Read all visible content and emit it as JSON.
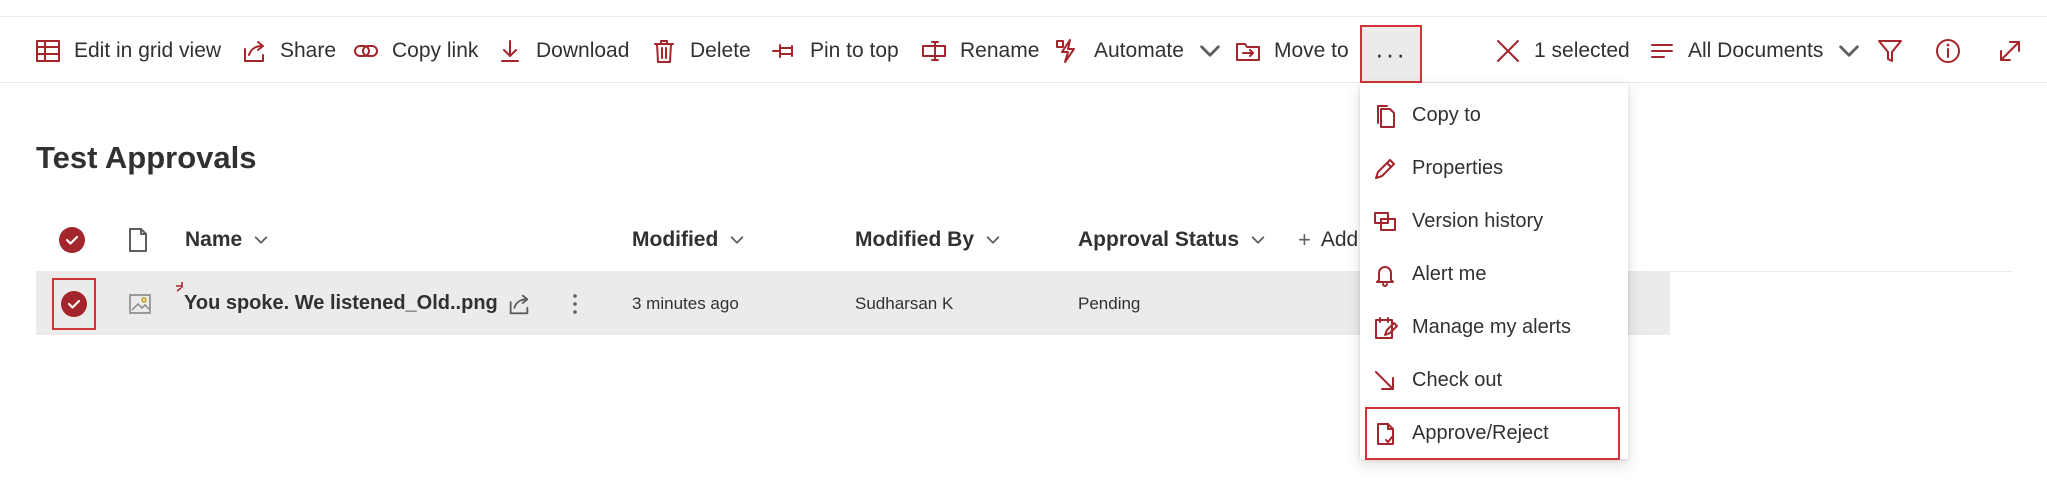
{
  "commandbar": {
    "items": [
      {
        "label": "Edit in grid view",
        "icon": "grid-icon"
      },
      {
        "label": "Share",
        "icon": "share-icon"
      },
      {
        "label": "Copy link",
        "icon": "link-icon"
      },
      {
        "label": "Download",
        "icon": "download-icon"
      },
      {
        "label": "Delete",
        "icon": "delete-icon"
      },
      {
        "label": "Pin to top",
        "icon": "pin-icon"
      },
      {
        "label": "Rename",
        "icon": "rename-icon"
      },
      {
        "label": "Automate",
        "icon": "automate-icon"
      },
      {
        "label": "Move to",
        "icon": "move-icon"
      }
    ],
    "more_label": "···",
    "selection_label": "1 selected",
    "view_label": "All Documents"
  },
  "library": {
    "title": "Test Approvals"
  },
  "columns": {
    "name": "Name",
    "modified": "Modified",
    "modified_by": "Modified By",
    "approval_status": "Approval Status",
    "add_column": "Add"
  },
  "rows": [
    {
      "name": "You spoke. We listened_Old..png",
      "modified": "3 minutes ago",
      "modified_by": "Sudharsan K",
      "approval_status": "Pending",
      "selected": true
    }
  ],
  "menu": {
    "items": [
      {
        "label": "Copy to",
        "icon": "copy-icon"
      },
      {
        "label": "Properties",
        "icon": "pencil-icon"
      },
      {
        "label": "Version history",
        "icon": "version-history-icon"
      },
      {
        "label": "Alert me",
        "icon": "bell-icon"
      },
      {
        "label": "Manage my alerts",
        "icon": "manage-alerts-icon"
      },
      {
        "label": "Check out",
        "icon": "check-out-icon"
      },
      {
        "label": "Approve/Reject",
        "icon": "approve-document-icon"
      }
    ]
  },
  "colors": {
    "accent": "#a4262c",
    "highlight_border": "#d13438",
    "selected_row": "#edebe9"
  }
}
